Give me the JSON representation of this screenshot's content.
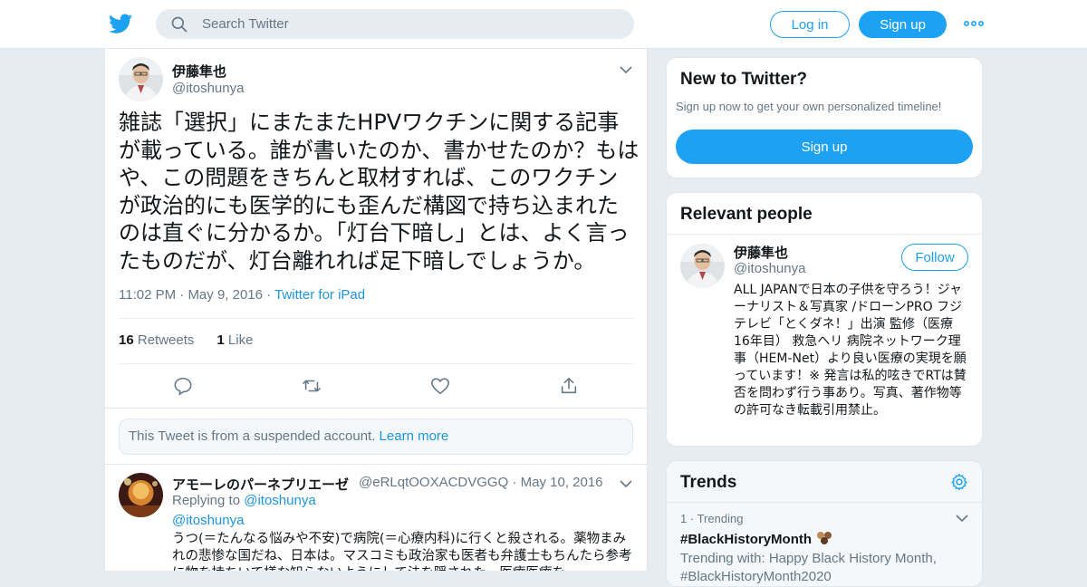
{
  "header": {
    "search_placeholder": "Search Twitter",
    "login_label": "Log in",
    "signup_label": "Sign up"
  },
  "tweet": {
    "author_name": "伊藤隼也",
    "author_handle": "@itoshunya",
    "text": "雑誌「選択」にまたまたHPVワクチンに関する記事が載っている。誰が書いたのか、書かせたのか？もはや、この問題をきちんと取材すれば、このワクチンが政治的にも医学的にも歪んだ構図で持ち込まれたのは直ぐに分かるか。「灯台下暗し」とは、よく言ったものだが、灯台離れれば足下暗しでしょうか。",
    "time": "11:02 PM",
    "date": "May 9, 2016",
    "source": "Twitter for iPad",
    "retweets_count": "16",
    "retweets_label": "Retweets",
    "likes_count": "1",
    "likes_label": "Like"
  },
  "suspended": {
    "text": "This Tweet is from a suspended account.",
    "link": "Learn more"
  },
  "reply": {
    "name": "アモーレのパーネプリエーゼ",
    "handle": "@eRLqtOOXACDVGGQ",
    "date": "May 10, 2016",
    "replying_label": "Replying to",
    "replying_handle": "@itoshunya",
    "mention": "@itoshunya",
    "text": "うつ(＝たんなる悩みや不安)で病院(＝心療内科)に行くと殺される。薬物まみれの悲惨な国だね、日本は。マスコミも政治家も医者も弁護士もちんたら参考に物を持ちいて様な知らないようにして法を隠された。医療医療を"
  },
  "new_to_twitter": {
    "title": "New to Twitter?",
    "subtitle": "Sign up now to get your own personalized timeline!",
    "button": "Sign up"
  },
  "relevant_people": {
    "title": "Relevant people",
    "name": "伊藤隼也",
    "handle": "@itoshunya",
    "follow_label": "Follow",
    "bio": "ALL JAPANで日本の子供を守ろう！ジャーナリスト＆写真家 /ドローンPRO フジテレビ「とくダネ！」出演 監修（医療 16年目） 救急ヘリ 病院ネットワーク理事（HEM-Net）より良い医療の実現を願っています！※ 発言は私的呟きでRTは賛否を問わず行う事あり。写真、著作物等の許可なき転載引用禁止。"
  },
  "trends": {
    "title": "Trends",
    "rank": "1",
    "rank_label": "Trending",
    "trend_name": "#BlackHistoryMonth",
    "trending_with": "Trending with: Happy Black History Month, #BlackHistoryMonth2020"
  },
  "colors": {
    "brand": "#1da1f2",
    "link": "#1b95e0",
    "muted": "#657786",
    "background": "#e6ecf0"
  },
  "icons": [
    "twitter-bird-icon",
    "search-icon",
    "more-icon",
    "chevron-down-icon",
    "reply-icon",
    "retweet-icon",
    "like-icon",
    "share-icon",
    "settings-icon"
  ]
}
